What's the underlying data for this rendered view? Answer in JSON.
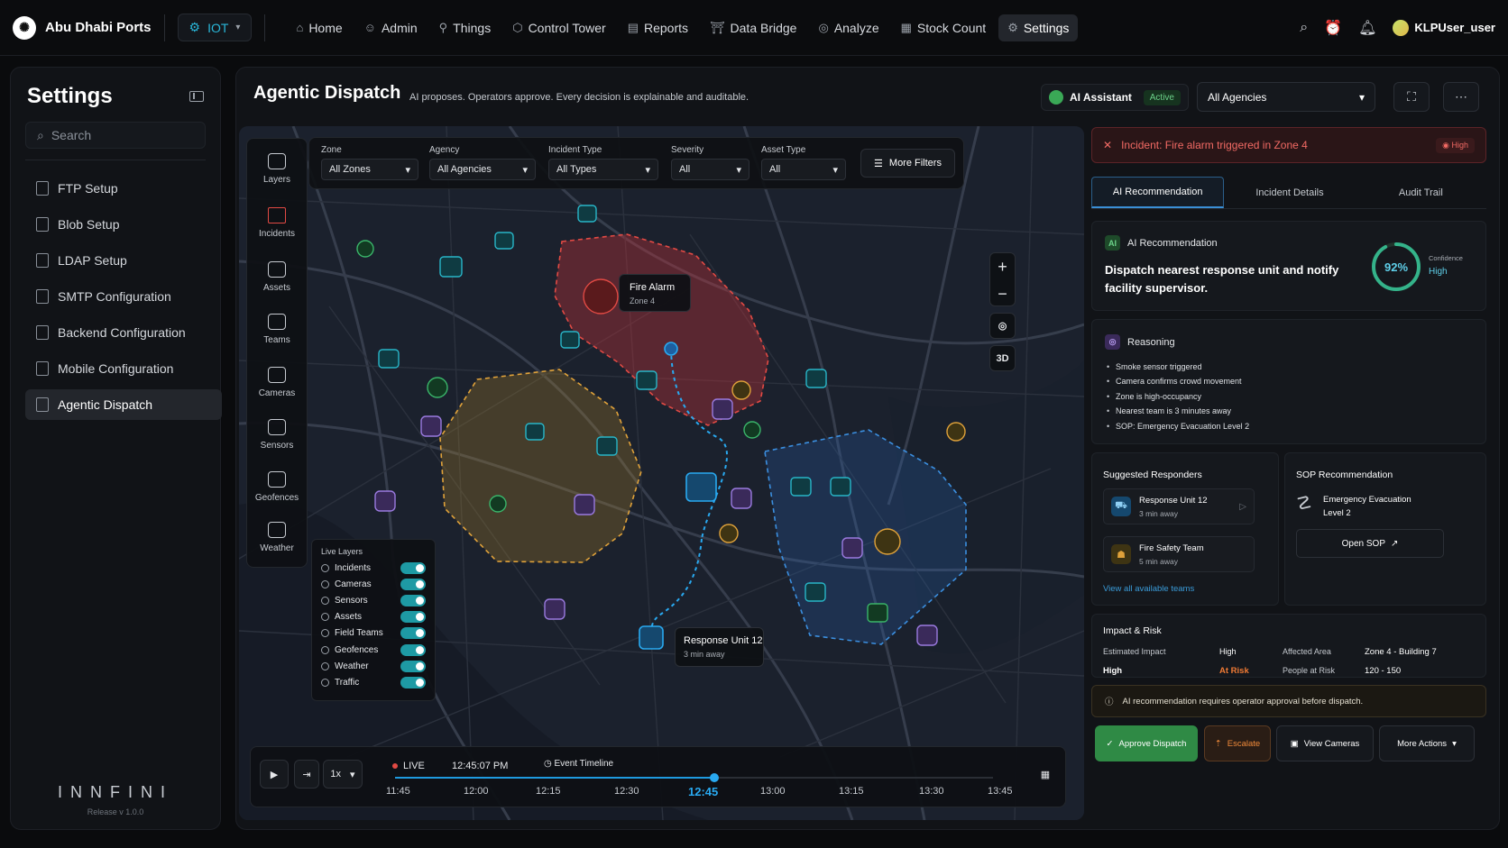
{
  "topbar": {
    "brand": "Abu Dhabi Ports",
    "module": "IOT",
    "nav": [
      {
        "label": "Home",
        "icon": "home-icon"
      },
      {
        "label": "Admin",
        "icon": "user-icon"
      },
      {
        "label": "Things",
        "icon": "things-icon"
      },
      {
        "label": "Control Tower",
        "icon": "tower-icon"
      },
      {
        "label": "Reports",
        "icon": "reports-icon"
      },
      {
        "label": "Data Bridge",
        "icon": "bridge-icon"
      },
      {
        "label": "Analyze",
        "icon": "analyze-icon"
      },
      {
        "label": "Stock Count",
        "icon": "stock-icon"
      },
      {
        "label": "Settings",
        "icon": "gear-icon",
        "active": true
      }
    ],
    "user": "KLPUser_user"
  },
  "sidebar": {
    "title": "Settings",
    "search_placeholder": "Search",
    "items": [
      {
        "label": "FTP Setup"
      },
      {
        "label": "Blob Setup"
      },
      {
        "label": "LDAP Setup"
      },
      {
        "label": "SMTP Configuration"
      },
      {
        "label": "Backend Configuration"
      },
      {
        "label": "Mobile Configuration"
      },
      {
        "label": "Agentic Dispatch",
        "active": true
      }
    ],
    "logo": "INNFINI",
    "version": "Release v 1.0.0"
  },
  "header": {
    "title": "Agentic Dispatch",
    "subtitle": "AI proposes. Operators approve. Every decision is explainable and auditable.",
    "assistant_label": "AI Assistant",
    "assistant_status": "Active",
    "agency_select": "All Agencies"
  },
  "map": {
    "filters": [
      {
        "label": "Zone",
        "value": "All Zones"
      },
      {
        "label": "Agency",
        "value": "All Agencies"
      },
      {
        "label": "Incident Type",
        "value": "All Types"
      },
      {
        "label": "Severity",
        "value": "All"
      },
      {
        "label": "Asset Type",
        "value": "All"
      }
    ],
    "more_filters": "More Filters",
    "layers": [
      {
        "label": "Layers"
      },
      {
        "label": "Incidents"
      },
      {
        "label": "Assets"
      },
      {
        "label": "Teams"
      },
      {
        "label": "Cameras"
      },
      {
        "label": "Sensors"
      },
      {
        "label": "Geofences"
      },
      {
        "label": "Weather"
      }
    ],
    "live_layers_title": "Live Layers",
    "live_layers": [
      {
        "label": "Incidents",
        "toggle": "on"
      },
      {
        "label": "Cameras",
        "toggle": "on"
      },
      {
        "label": "Sensors",
        "toggle": "on"
      },
      {
        "label": "Assets",
        "toggle": "on"
      },
      {
        "label": "Field Teams",
        "toggle": "on"
      },
      {
        "label": "Geofences",
        "toggle": "on"
      },
      {
        "label": "Weather",
        "toggle": "on"
      },
      {
        "label": "Traffic",
        "toggle": "on"
      }
    ],
    "fire_label": "Fire Alarm",
    "fire_zone": "Zone 4",
    "unit_label": "Response Unit 12",
    "unit_eta": "3 min away",
    "btn_3d": "3D",
    "timeline": {
      "speed": "1x",
      "live": "LIVE",
      "time": "12:45:07 PM",
      "event": "Event Timeline",
      "ticks": [
        "11:45",
        "12:00",
        "12:15",
        "12:30",
        "12:45",
        "13:00",
        "13:15",
        "13:30",
        "13:45"
      ],
      "current": "12:45"
    }
  },
  "panel": {
    "incident": "Incident: Fire alarm triggered in Zone 4",
    "severity": "High",
    "tabs": [
      "AI Recommendation",
      "Incident Details",
      "Audit Trail"
    ],
    "reco_title": "AI Recommendation",
    "reco_badge": "AI",
    "reco_text": "Dispatch nearest response unit and notify facility supervisor.",
    "confidence_value": "92%",
    "confidence_pct": 92,
    "confidence_label": "Confidence",
    "confidence_level": "High",
    "reasoning_title": "Reasoning",
    "reasons": [
      "Smoke sensor triggered",
      "Camera confirms crowd movement",
      "Zone is high-occupancy",
      "Nearest team is 3 minutes away",
      "SOP: Emergency Evacuation Level 2"
    ],
    "suggested_title": "Suggested Responders",
    "responders": [
      {
        "name": "Response Unit 12",
        "eta": "3 min away"
      },
      {
        "name": "Fire Safety Team",
        "eta": "5 min away"
      }
    ],
    "view_all": "View all available teams",
    "sop_title": "SOP Recommendation",
    "sop_line1": "Emergency Evacuation",
    "sop_line2": "Level 2",
    "open_sop": "Open SOP",
    "impact_title": "Impact & Risk",
    "est_impact_label": "Estimated Impact",
    "est_impact_value": "High",
    "high_label": "High",
    "at_risk": "At Risk",
    "affected_area_label": "Affected Area",
    "affected_area_value": "Zone 4 - Building 7",
    "people_label": "People at Risk",
    "people_value": "120 - 150",
    "notice": "AI recommendation requires operator approval before dispatch.",
    "actions": {
      "approve": "Approve Dispatch",
      "escalate": "Escalate",
      "cameras": "View Cameras",
      "more": "More Actions"
    }
  },
  "colors": {
    "accent_blue": "#29a9f0",
    "danger": "#e24a44",
    "success": "#2f8a45",
    "warning": "#e0a23a"
  }
}
